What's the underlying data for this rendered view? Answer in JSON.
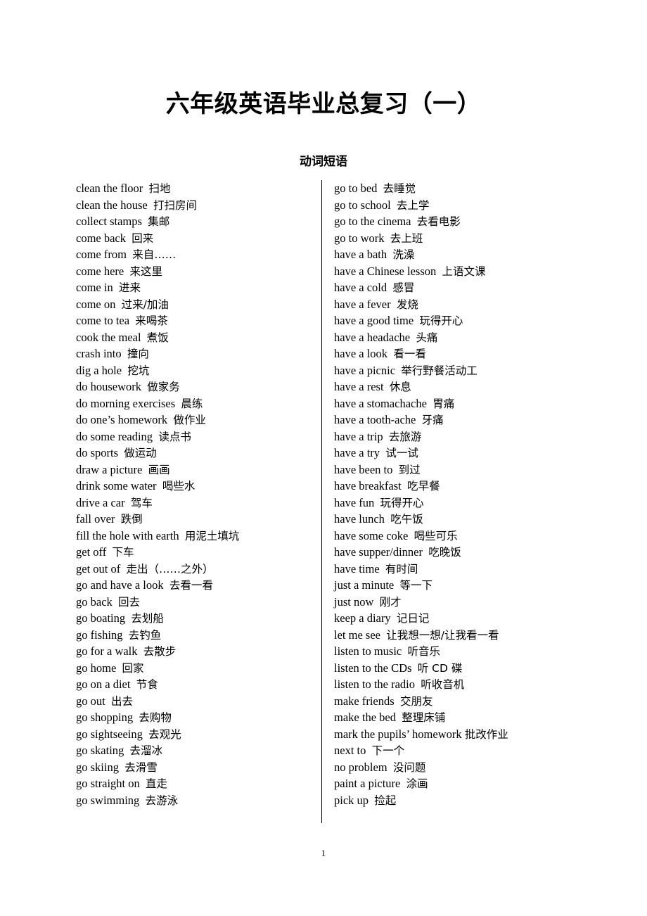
{
  "document": {
    "title": "六年级英语毕业总复习（一）",
    "subtitle": "动词短语",
    "page_number": "1"
  },
  "columns": {
    "left": [
      {
        "en": "clean the floor",
        "zh": "扫地"
      },
      {
        "en": "clean the house",
        "zh": "打扫房间"
      },
      {
        "en": "collect stamps",
        "zh": "集邮"
      },
      {
        "en": "come back",
        "zh": "回来"
      },
      {
        "en": "come from",
        "zh": "来自……"
      },
      {
        "en": "come here",
        "zh": "来这里"
      },
      {
        "en": "come in",
        "zh": "进来"
      },
      {
        "en": "come on",
        "zh": "过来/加油"
      },
      {
        "en": "come to tea",
        "zh": "来喝茶"
      },
      {
        "en": "cook the meal",
        "zh": "煮饭"
      },
      {
        "en": "crash into",
        "zh": "撞向"
      },
      {
        "en": "dig a hole",
        "zh": "挖坑"
      },
      {
        "en": "do housework",
        "zh": "做家务"
      },
      {
        "en": "do morning exercises",
        "zh": "晨练"
      },
      {
        "en": "do one’s homework",
        "zh": "做作业"
      },
      {
        "en": "do some reading",
        "zh": "读点书"
      },
      {
        "en": "do sports",
        "zh": "做运动"
      },
      {
        "en": "draw a picture",
        "zh": "画画"
      },
      {
        "en": "drink some water",
        "zh": "喝些水"
      },
      {
        "en": "drive a car",
        "zh": "驾车"
      },
      {
        "en": "fall over",
        "zh": "跌倒"
      },
      {
        "en": "fill the hole with earth",
        "zh": "用泥土填坑"
      },
      {
        "en": "get off",
        "zh": "下车"
      },
      {
        "en": "get out of",
        "zh": "走出（……之外）"
      },
      {
        "en": "go and have a look",
        "zh": "去看一看"
      },
      {
        "en": "go back",
        "zh": "回去"
      },
      {
        "en": "go boating",
        "zh": "去划船"
      },
      {
        "en": "go fishing",
        "zh": "去钓鱼"
      },
      {
        "en": "go for a walk",
        "zh": "去散步"
      },
      {
        "en": "go home",
        "zh": "回家"
      },
      {
        "en": "go on a diet",
        "zh": "节食"
      },
      {
        "en": "go out",
        "zh": "出去"
      },
      {
        "en": "go shopping",
        "zh": "去购物"
      },
      {
        "en": "go sightseeing",
        "zh": "去观光"
      },
      {
        "en": "go skating",
        "zh": "去溜冰"
      },
      {
        "en": "go skiing",
        "zh": "去滑雪"
      },
      {
        "en": "go straight on",
        "zh": "直走"
      },
      {
        "en": "go swimming",
        "zh": "去游泳"
      }
    ],
    "right": [
      {
        "en": "go to bed",
        "zh": "去睡觉"
      },
      {
        "en": "go to school",
        "zh": "去上学"
      },
      {
        "en": "go to the cinema",
        "zh": "去看电影"
      },
      {
        "en": "go to work",
        "zh": "去上班"
      },
      {
        "en": "have a bath",
        "zh": "洗澡"
      },
      {
        "en": "have a Chinese lesson",
        "zh": "上语文课"
      },
      {
        "en": "have a cold",
        "zh": "感冒"
      },
      {
        "en": "have a fever",
        "zh": "发烧"
      },
      {
        "en": "have a good time",
        "zh": "玩得开心"
      },
      {
        "en": "have a headache",
        "zh": "头痛"
      },
      {
        "en": "have a look",
        "zh": "看一看"
      },
      {
        "en": "have a picnic",
        "zh": "举行野餐活动工"
      },
      {
        "en": "have a rest",
        "zh": "休息"
      },
      {
        "en": "have a stomachache",
        "zh": "胃痛"
      },
      {
        "en": "have a tooth-ache",
        "zh": "牙痛"
      },
      {
        "en": "have a trip",
        "zh": "去旅游"
      },
      {
        "en": "have a try",
        "zh": "试一试"
      },
      {
        "en": "have been to",
        "zh": "到过"
      },
      {
        "en": "have breakfast",
        "zh": "吃早餐"
      },
      {
        "en": "have fun",
        "zh": "玩得开心"
      },
      {
        "en": "have lunch",
        "zh": "吃午饭"
      },
      {
        "en": "have some coke",
        "zh": "喝些可乐"
      },
      {
        "en": "have supper/dinner",
        "zh": "吃晚饭"
      },
      {
        "en": "have time",
        "zh": "有时间"
      },
      {
        "en": "just a minute",
        "zh": "等一下"
      },
      {
        "en": "just now",
        "zh": "刚才"
      },
      {
        "en": "keep a diary",
        "zh": "记日记"
      },
      {
        "en": "let me see",
        "zh": "让我想一想/让我看一看"
      },
      {
        "en": "listen to music",
        "zh": "听音乐"
      },
      {
        "en": "listen to the CDs",
        "zh": "听 CD 碟"
      },
      {
        "en": "listen to the radio",
        "zh": "听收音机"
      },
      {
        "en": "make friends",
        "zh": "交朋友"
      },
      {
        "en": "make the bed",
        "zh": "整理床铺"
      },
      {
        "en": "mark the pupils’ homework",
        "zh": "批改作业"
      },
      {
        "en": "next to",
        "zh": "下一个"
      },
      {
        "en": "no problem",
        "zh": "没问题"
      },
      {
        "en": "paint a picture",
        "zh": "涂画"
      },
      {
        "en": "pick up",
        "zh": "捡起"
      }
    ]
  }
}
